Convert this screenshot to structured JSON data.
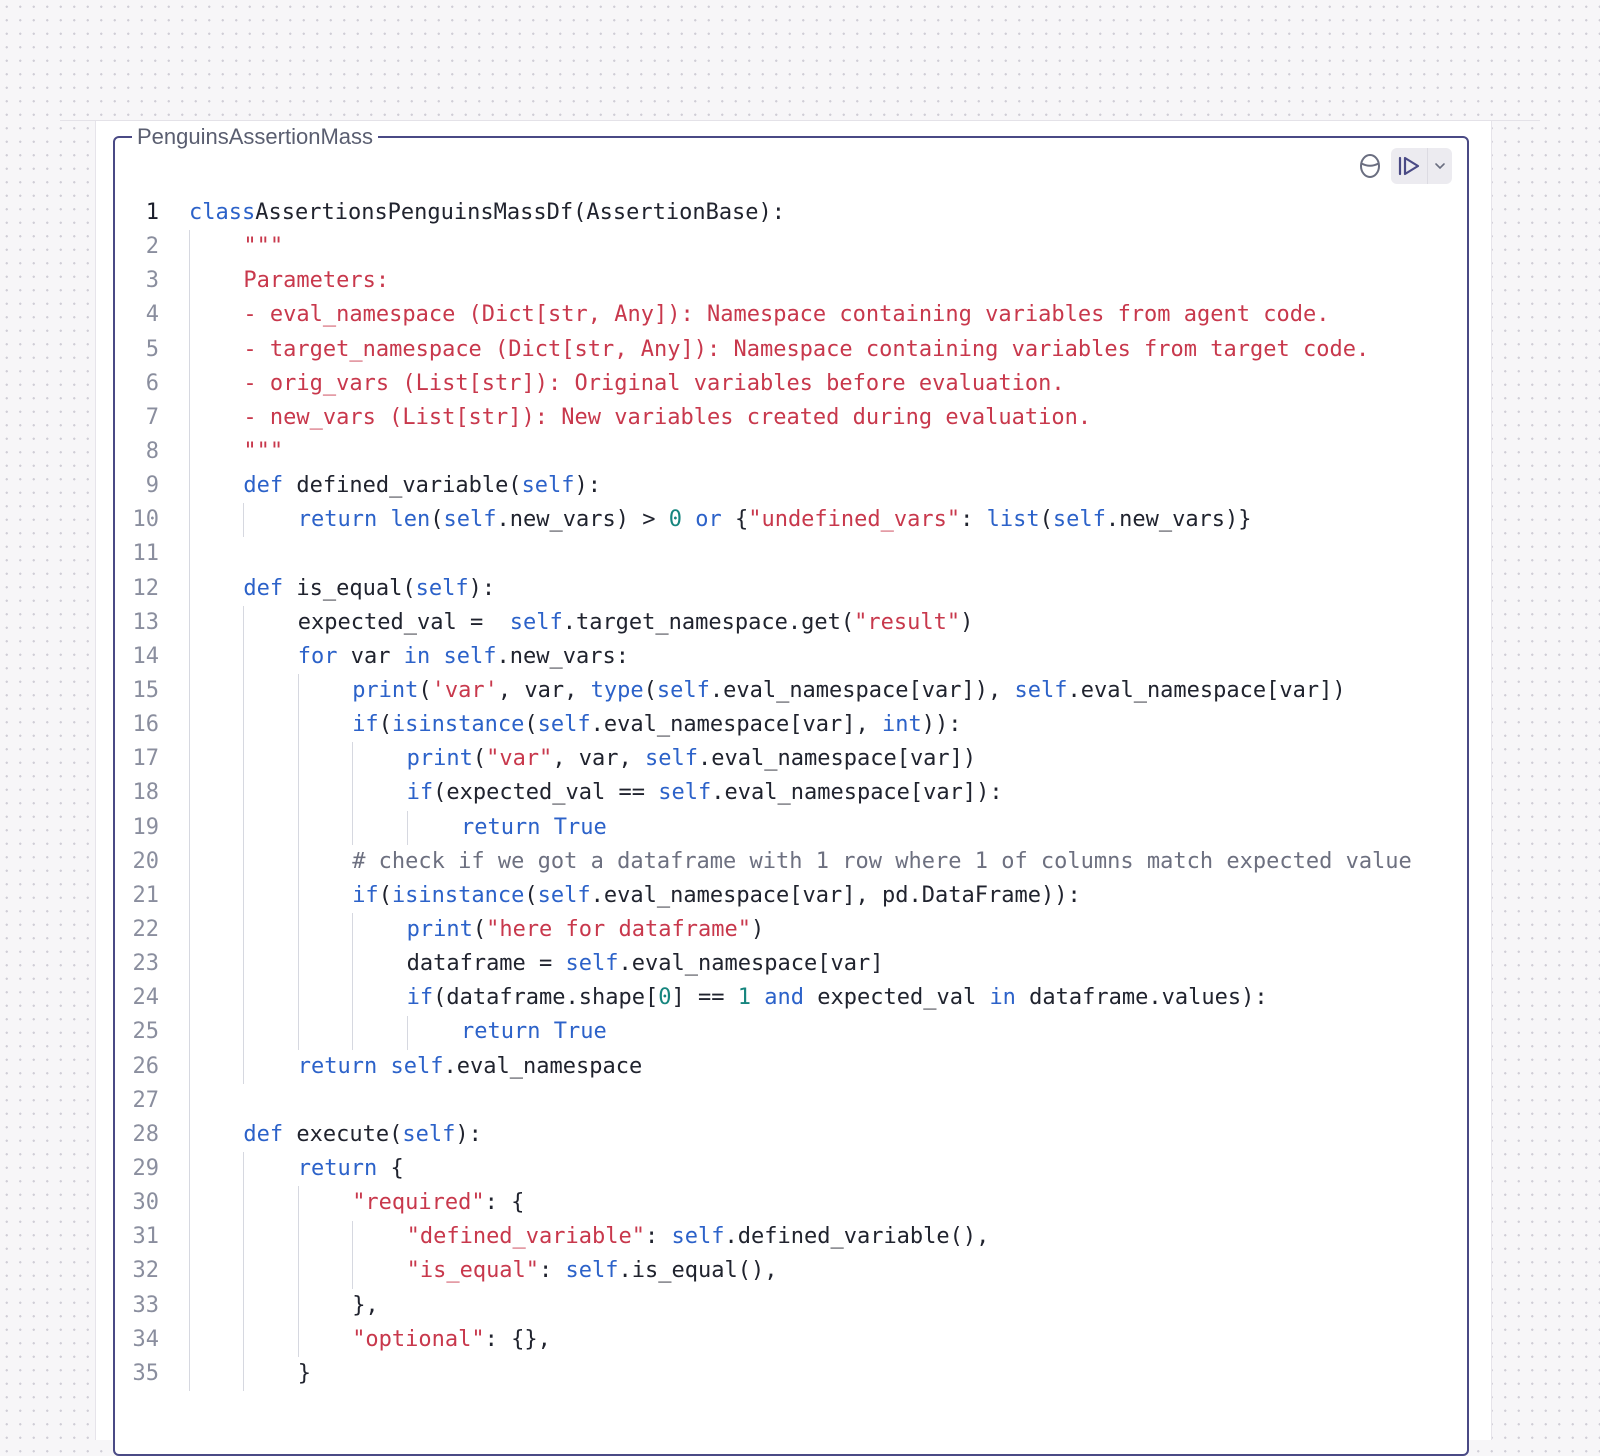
{
  "cell": {
    "title": "PenguinsAssertionMass",
    "toolbar": {
      "database_icon": "database-icon",
      "run_icon": "run-cell-icon",
      "dropdown_icon": "chevron-down-icon"
    }
  },
  "editor": {
    "active_line": 1,
    "colors": {
      "keyword": "#2c62c9",
      "string": "#c8384c",
      "number": "#16857e",
      "comment": "#6d7080",
      "default": "#20232e",
      "frame": "#4a4a85"
    },
    "lines": [
      {
        "n": "1",
        "indent": 0,
        "tokens": [
          [
            "kw",
            "class"
          ],
          [
            "",
            "AssertionsPenguinsMassDf(AssertionBase):"
          ]
        ]
      },
      {
        "n": "2",
        "indent": 1,
        "tokens": [
          [
            "str",
            "\"\"\""
          ]
        ]
      },
      {
        "n": "3",
        "indent": 1,
        "tokens": [
          [
            "str",
            "Parameters:"
          ]
        ]
      },
      {
        "n": "4",
        "indent": 1,
        "tokens": [
          [
            "str",
            "- eval_namespace (Dict[str, Any]): Namespace containing variables from agent code."
          ]
        ]
      },
      {
        "n": "5",
        "indent": 1,
        "tokens": [
          [
            "str",
            "- target_namespace (Dict[str, Any]): Namespace containing variables from target code."
          ]
        ]
      },
      {
        "n": "6",
        "indent": 1,
        "tokens": [
          [
            "str",
            "- orig_vars (List[str]): Original variables before evaluation."
          ]
        ]
      },
      {
        "n": "7",
        "indent": 1,
        "tokens": [
          [
            "str",
            "- new_vars (List[str]): New variables created during evaluation."
          ]
        ]
      },
      {
        "n": "8",
        "indent": 1,
        "tokens": [
          [
            "str",
            "\"\"\""
          ]
        ]
      },
      {
        "n": "9",
        "indent": 1,
        "tokens": [
          [
            "kw",
            "def"
          ],
          [
            "",
            " defined_variable("
          ],
          [
            "kw",
            "self"
          ],
          [
            "",
            "):"
          ]
        ]
      },
      {
        "n": "10",
        "indent": 2,
        "tokens": [
          [
            "kw",
            "return"
          ],
          [
            "",
            " "
          ],
          [
            "kw",
            "len"
          ],
          [
            "",
            "("
          ],
          [
            "kw",
            "self"
          ],
          [
            "",
            ".new_vars) > "
          ],
          [
            "num",
            "0"
          ],
          [
            "",
            " "
          ],
          [
            "kw",
            "or"
          ],
          [
            "",
            " {"
          ],
          [
            "str",
            "\"undefined_vars\""
          ],
          [
            "",
            ": "
          ],
          [
            "kw",
            "list"
          ],
          [
            "",
            "("
          ],
          [
            "kw",
            "self"
          ],
          [
            "",
            ".new_vars)}"
          ]
        ]
      },
      {
        "n": "11",
        "indent": 0,
        "tokens": []
      },
      {
        "n": "12",
        "indent": 1,
        "tokens": [
          [
            "kw",
            "def"
          ],
          [
            "",
            " is_equal("
          ],
          [
            "kw",
            "self"
          ],
          [
            "",
            "):"
          ]
        ]
      },
      {
        "n": "13",
        "indent": 2,
        "tokens": [
          [
            "",
            "expected_val =  "
          ],
          [
            "kw",
            "self"
          ],
          [
            "",
            ".target_namespace.get("
          ],
          [
            "str",
            "\"result\""
          ],
          [
            "",
            ")"
          ]
        ]
      },
      {
        "n": "14",
        "indent": 2,
        "tokens": [
          [
            "kw",
            "for"
          ],
          [
            "",
            " var "
          ],
          [
            "kw",
            "in"
          ],
          [
            "",
            " "
          ],
          [
            "kw",
            "self"
          ],
          [
            "",
            ".new_vars:"
          ]
        ]
      },
      {
        "n": "15",
        "indent": 3,
        "tokens": [
          [
            "kw",
            "print"
          ],
          [
            "",
            "("
          ],
          [
            "str",
            "'var'"
          ],
          [
            "",
            ", var, "
          ],
          [
            "kw",
            "type"
          ],
          [
            "",
            "("
          ],
          [
            "kw",
            "self"
          ],
          [
            "",
            ".eval_namespace[var]), "
          ],
          [
            "kw",
            "self"
          ],
          [
            "",
            ".eval_namespace[var])"
          ]
        ]
      },
      {
        "n": "16",
        "indent": 3,
        "tokens": [
          [
            "kw",
            "if"
          ],
          [
            "",
            "("
          ],
          [
            "kw",
            "isinstance"
          ],
          [
            "",
            "("
          ],
          [
            "kw",
            "self"
          ],
          [
            "",
            ".eval_namespace[var], "
          ],
          [
            "kw",
            "int"
          ],
          [
            "",
            "))"
          ],
          [
            "",
            ":"
          ]
        ]
      },
      {
        "n": "17",
        "indent": 4,
        "tokens": [
          [
            "kw",
            "print"
          ],
          [
            "",
            "("
          ],
          [
            "str",
            "\"var\""
          ],
          [
            "",
            ", var, "
          ],
          [
            "kw",
            "self"
          ],
          [
            "",
            ".eval_namespace[var])"
          ]
        ]
      },
      {
        "n": "18",
        "indent": 4,
        "tokens": [
          [
            "kw",
            "if"
          ],
          [
            "",
            "(expected_val == "
          ],
          [
            "kw",
            "self"
          ],
          [
            "",
            ".eval_namespace[var]):"
          ]
        ]
      },
      {
        "n": "19",
        "indent": 5,
        "tokens": [
          [
            "kw",
            "return"
          ],
          [
            "",
            " "
          ],
          [
            "kw",
            "True"
          ]
        ]
      },
      {
        "n": "20",
        "indent": 3,
        "tokens": [
          [
            "cm",
            "# check if we got a dataframe with 1 row where 1 of columns match expected value"
          ]
        ]
      },
      {
        "n": "21",
        "indent": 3,
        "tokens": [
          [
            "kw",
            "if"
          ],
          [
            "",
            "("
          ],
          [
            "kw",
            "isinstance"
          ],
          [
            "",
            "("
          ],
          [
            "kw",
            "self"
          ],
          [
            "",
            ".eval_namespace[var], pd.DataFrame)):"
          ]
        ]
      },
      {
        "n": "22",
        "indent": 4,
        "tokens": [
          [
            "kw",
            "print"
          ],
          [
            "",
            "("
          ],
          [
            "str",
            "\"here for dataframe\""
          ],
          [
            "",
            ")"
          ]
        ]
      },
      {
        "n": "23",
        "indent": 4,
        "tokens": [
          [
            "",
            "dataframe = "
          ],
          [
            "kw",
            "self"
          ],
          [
            "",
            ".eval_namespace[var]"
          ]
        ]
      },
      {
        "n": "24",
        "indent": 4,
        "tokens": [
          [
            "kw",
            "if"
          ],
          [
            "",
            "(dataframe.shape["
          ],
          [
            "num",
            "0"
          ],
          [
            "",
            "] == "
          ],
          [
            "num",
            "1"
          ],
          [
            "",
            " "
          ],
          [
            "kw",
            "and"
          ],
          [
            "",
            " expected_val "
          ],
          [
            "kw",
            "in"
          ],
          [
            "",
            " dataframe.values):"
          ]
        ]
      },
      {
        "n": "25",
        "indent": 5,
        "tokens": [
          [
            "kw",
            "return"
          ],
          [
            "",
            " "
          ],
          [
            "kw",
            "True"
          ]
        ]
      },
      {
        "n": "26",
        "indent": 2,
        "tokens": [
          [
            "kw",
            "return"
          ],
          [
            "",
            " "
          ],
          [
            "kw",
            "self"
          ],
          [
            "",
            ".eval_namespace"
          ]
        ]
      },
      {
        "n": "27",
        "indent": 0,
        "tokens": []
      },
      {
        "n": "28",
        "indent": 1,
        "tokens": [
          [
            "kw",
            "def"
          ],
          [
            "",
            " execute("
          ],
          [
            "kw",
            "self"
          ],
          [
            "",
            "):"
          ]
        ]
      },
      {
        "n": "29",
        "indent": 2,
        "tokens": [
          [
            "kw",
            "return"
          ],
          [
            "",
            " {"
          ]
        ]
      },
      {
        "n": "30",
        "indent": 3,
        "tokens": [
          [
            "str",
            "\"required\""
          ],
          [
            "",
            ": {"
          ]
        ]
      },
      {
        "n": "31",
        "indent": 4,
        "tokens": [
          [
            "str",
            "\"defined_variable\""
          ],
          [
            "",
            ": "
          ],
          [
            "kw",
            "self"
          ],
          [
            "",
            ".defined_variable(),"
          ]
        ]
      },
      {
        "n": "32",
        "indent": 4,
        "tokens": [
          [
            "str",
            "\"is_equal\""
          ],
          [
            "",
            ": "
          ],
          [
            "kw",
            "self"
          ],
          [
            "",
            ".is_equal(),"
          ]
        ]
      },
      {
        "n": "33",
        "indent": 3,
        "tokens": [
          [
            "",
            "},"
          ]
        ]
      },
      {
        "n": "34",
        "indent": 3,
        "tokens": [
          [
            "str",
            "\"optional\""
          ],
          [
            "",
            ": {},"
          ]
        ]
      },
      {
        "n": "35",
        "indent": 2,
        "tokens": [
          [
            "",
            "}"
          ]
        ]
      }
    ]
  }
}
